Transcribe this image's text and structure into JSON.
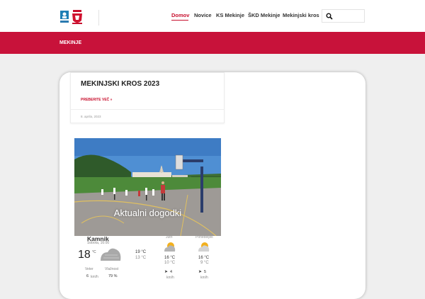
{
  "nav": {
    "items": [
      "Domov",
      "Novice",
      "KS Mekinje",
      "ŠKD Mekinje",
      "Mekinjski kros"
    ]
  },
  "banner": {
    "title": "MEKINJE"
  },
  "post": {
    "title": "MEKINJSKI KROS 2023",
    "read_more": "PREBERITE VEČ »",
    "date": "8. aprila, 2023"
  },
  "photo": {
    "caption": "Aktualni dogodki"
  },
  "weather": {
    "city": "Kamnik",
    "datetime": "Sobota, 16:00",
    "temp": "18",
    "unit": "°C",
    "current_hi": "19 °C",
    "current_lo": "13 °C",
    "wind_label": "Veter",
    "wind_value": "6",
    "wind_unit": "km/h",
    "humidity_label": "Vlažnost",
    "humidity_value": "79 %",
    "forecast": [
      {
        "day": "Jutri",
        "hi": "16 °C",
        "lo": "10 °C",
        "wind": "4",
        "wind_unit": "km/h"
      },
      {
        "day": "Ponedeljek",
        "hi": "16 °C",
        "lo": "9 °C",
        "wind": "5",
        "wind_unit": "km/h"
      }
    ]
  },
  "colors": {
    "brand_red": "#c8123a",
    "active_nav": "#c8102e"
  },
  "icons": [
    "school-logo",
    "club-logo",
    "search-icon",
    "cloud-icon",
    "partly-cloudy-icon",
    "wind-arrow-icon"
  ]
}
